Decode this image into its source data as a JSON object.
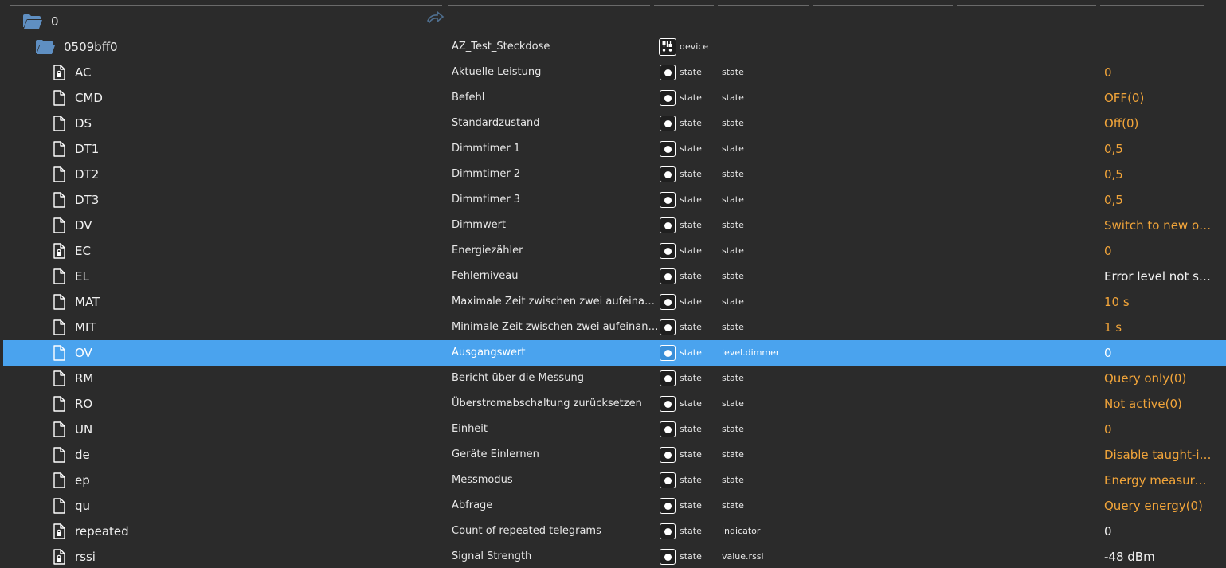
{
  "tree": {
    "root": {
      "id": "0"
    },
    "device": {
      "id": "0509bff0",
      "name": "AZ_Test_Steckdose",
      "type": "device"
    },
    "rows": [
      {
        "id": "AC",
        "locked": true,
        "name": "Aktuelle Leistung",
        "type": "state",
        "role": "state",
        "value": "0",
        "value_color": "orange",
        "selected": false
      },
      {
        "id": "CMD",
        "locked": false,
        "name": "Befehl",
        "type": "state",
        "role": "state",
        "value": "OFF(0)",
        "value_color": "orange",
        "selected": false
      },
      {
        "id": "DS",
        "locked": false,
        "name": "Standardzustand",
        "type": "state",
        "role": "state",
        "value": "Off(0)",
        "value_color": "orange",
        "selected": false
      },
      {
        "id": "DT1",
        "locked": false,
        "name": "Dimmtimer 1",
        "type": "state",
        "role": "state",
        "value": "0,5",
        "value_color": "orange",
        "selected": false
      },
      {
        "id": "DT2",
        "locked": false,
        "name": "Dimmtimer 2",
        "type": "state",
        "role": "state",
        "value": "0,5",
        "value_color": "orange",
        "selected": false
      },
      {
        "id": "DT3",
        "locked": false,
        "name": "Dimmtimer 3",
        "type": "state",
        "role": "state",
        "value": "0,5",
        "value_color": "orange",
        "selected": false
      },
      {
        "id": "DV",
        "locked": false,
        "name": "Dimmwert",
        "type": "state",
        "role": "state",
        "value": "Switch to new out...",
        "value_color": "orange",
        "selected": false
      },
      {
        "id": "EC",
        "locked": true,
        "name": "Energiezähler",
        "type": "state",
        "role": "state",
        "value": "0",
        "value_color": "orange",
        "selected": false
      },
      {
        "id": "EL",
        "locked": false,
        "name": "Fehlerniveau",
        "type": "state",
        "role": "state",
        "value": "Error level not su...",
        "value_color": "white",
        "selected": false
      },
      {
        "id": "MAT",
        "locked": false,
        "name": "Maximale Zeit zwischen zwei aufeinander...",
        "type": "state",
        "role": "state",
        "value": "10 s",
        "value_color": "orange",
        "selected": false
      },
      {
        "id": "MIT",
        "locked": false,
        "name": "Minimale Zeit zwischen zwei aufeinander...",
        "type": "state",
        "role": "state",
        "value": "1 s",
        "value_color": "orange",
        "selected": false
      },
      {
        "id": "OV",
        "locked": false,
        "name": "Ausgangswert",
        "type": "state",
        "role": "level.dimmer",
        "value": "0",
        "value_color": "white",
        "selected": true
      },
      {
        "id": "RM",
        "locked": false,
        "name": "Bericht über die Messung",
        "type": "state",
        "role": "state",
        "value": "Query only(0)",
        "value_color": "orange",
        "selected": false
      },
      {
        "id": "RO",
        "locked": false,
        "name": "Überstromabschaltung zurücksetzen",
        "type": "state",
        "role": "state",
        "value": "Not active(0)",
        "value_color": "orange",
        "selected": false
      },
      {
        "id": "UN",
        "locked": false,
        "name": "Einheit",
        "type": "state",
        "role": "state",
        "value": "0",
        "value_color": "orange",
        "selected": false
      },
      {
        "id": "de",
        "locked": false,
        "name": "Geräte Einlernen",
        "type": "state",
        "role": "state",
        "value": "Disable taught-in ...",
        "value_color": "orange",
        "selected": false
      },
      {
        "id": "ep",
        "locked": false,
        "name": "Messmodus",
        "type": "state",
        "role": "state",
        "value": "Energy measurem...",
        "value_color": "orange",
        "selected": false
      },
      {
        "id": "qu",
        "locked": false,
        "name": "Abfrage",
        "type": "state",
        "role": "state",
        "value": "Query energy(0)",
        "value_color": "orange",
        "selected": false
      },
      {
        "id": "repeated",
        "locked": true,
        "name": "Count of repeated telegrams",
        "type": "state",
        "role": "indicator",
        "value": "0",
        "value_color": "white",
        "selected": false
      },
      {
        "id": "rssi",
        "locked": true,
        "name": "Signal Strength",
        "type": "state",
        "role": "value.rssi",
        "value": "-48 dBm",
        "value_color": "white",
        "selected": false
      }
    ]
  },
  "colors": {
    "background": "#2b2b2b",
    "selected_row": "#4aa3ee",
    "value_orange": "#f2a53a",
    "folder": "#5f8fc2"
  },
  "icons": {
    "folder": "folder-open-icon",
    "file": "file-icon",
    "locked_file": "file-lock-icon",
    "state": "state-dot-icon",
    "device": "device-icon",
    "edit": "edit-icon"
  }
}
